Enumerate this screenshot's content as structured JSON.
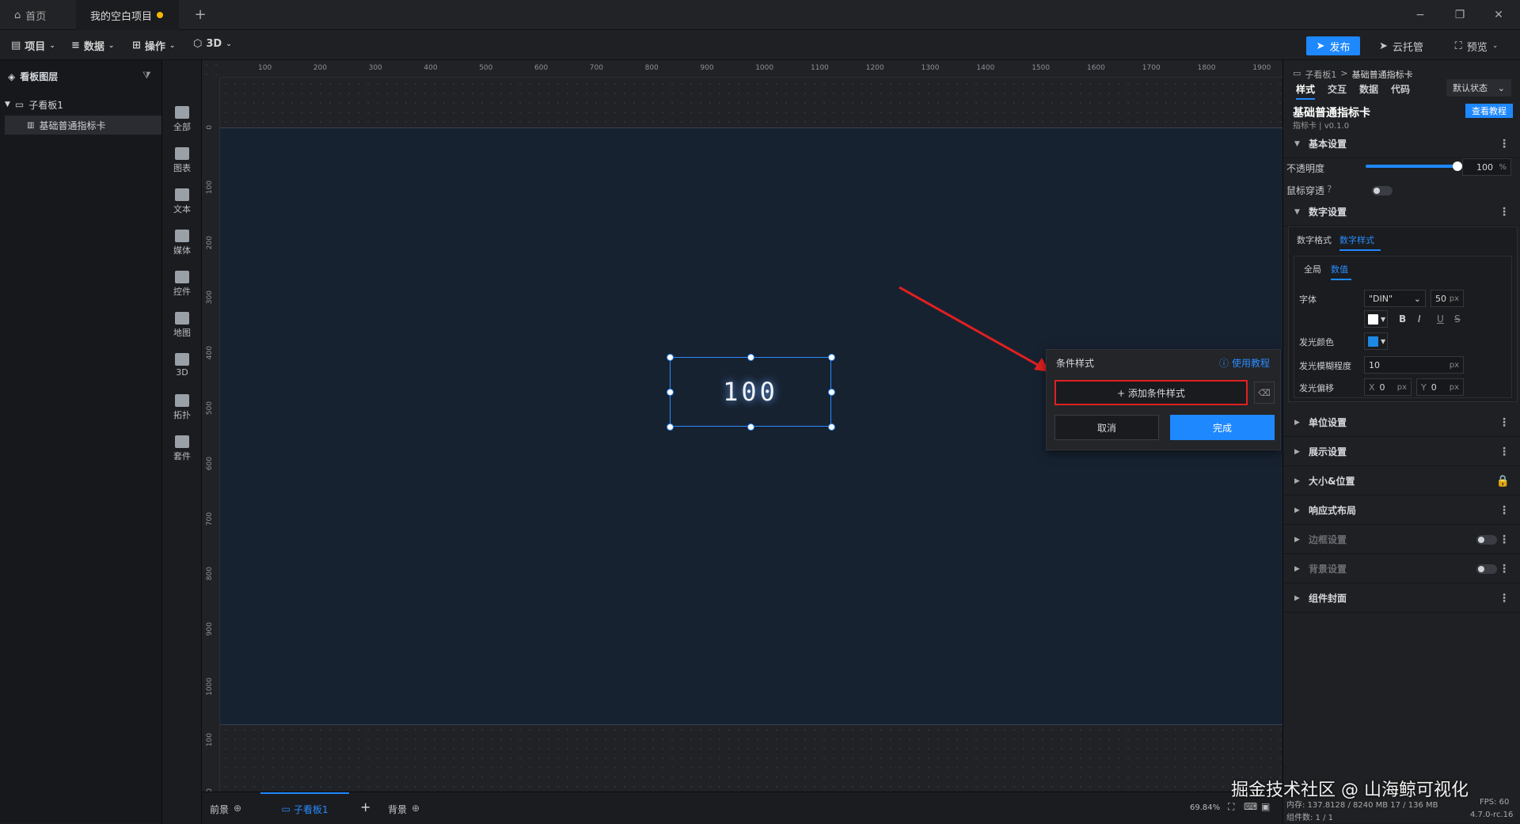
{
  "titlebar": {
    "tabs": [
      {
        "label": "首页"
      },
      {
        "label": "我的空白项目"
      }
    ],
    "add_tab": "+",
    "minimize": "−",
    "restore": "❐",
    "close": "✕"
  },
  "menubar": {
    "items": [
      {
        "label": "项目"
      },
      {
        "label": "数据"
      },
      {
        "label": "操作"
      },
      {
        "label": "3D"
      }
    ],
    "publish": "发布",
    "cloud": "云托管",
    "preview": "预览"
  },
  "layers": {
    "title": "看板图层",
    "board": "子看板1",
    "widget": "基础普通指标卡"
  },
  "components": [
    {
      "label": "全部"
    },
    {
      "label": "图表"
    },
    {
      "label": "文本"
    },
    {
      "label": "媒体"
    },
    {
      "label": "控件"
    },
    {
      "label": "地图"
    },
    {
      "label": "3D"
    },
    {
      "label": "拓扑"
    },
    {
      "label": "套件"
    }
  ],
  "ruler": {
    "top": [
      "100",
      "200",
      "300",
      "400",
      "500",
      "600",
      "700",
      "800",
      "900",
      "1000",
      "1100",
      "1200",
      "1300",
      "1400",
      "1500",
      "1600",
      "1700",
      "1800",
      "1900"
    ],
    "left": [
      "0",
      "100",
      "200",
      "300",
      "400",
      "500",
      "600",
      "700",
      "800",
      "900",
      "1000",
      "100",
      "00"
    ]
  },
  "widget": {
    "value": "100"
  },
  "popup": {
    "title": "条件样式",
    "help": "使用教程",
    "add_button": "+ 添加条件样式",
    "cancel": "取消",
    "done": "完成"
  },
  "bottombar": {
    "front": "前景",
    "board_tab": "子看板1",
    "add": "+",
    "back": "背景",
    "zoom": "69.84%",
    "mem": "内存: 137.8128 / 8240 MB 17 / 136 MB",
    "fps": "FPS: 60",
    "count": "组件数: 1 / 1",
    "version": "4.7.0-rc.16",
    "watermark": "掘金技术社区 @ 山海鲸可视化"
  },
  "rpanel": {
    "breadcrumb_parent": "子看板1",
    "breadcrumb_sep": ">",
    "breadcrumb_current": "基础普通指标卡",
    "tabs": [
      {
        "label": "样式"
      },
      {
        "label": "交互"
      },
      {
        "label": "数据"
      },
      {
        "label": "代码"
      }
    ],
    "state": "默认状态",
    "widget_name": "基础普通指标卡",
    "widget_version": "指标卡 | v0.1.0",
    "tutorial": "查看教程",
    "basic": {
      "title": "基本设置",
      "opacity_label": "不透明度",
      "opacity_value": "100",
      "opacity_unit": "%",
      "opacity_fraction": 1.0,
      "mouse_through": "鼠标穿透"
    },
    "number": {
      "title": "数字设置",
      "subtabs": [
        {
          "label": "数字格式"
        },
        {
          "label": "数字样式"
        }
      ],
      "scope_tabs": [
        {
          "label": "全局"
        },
        {
          "label": "数值"
        }
      ],
      "font_label": "字体",
      "font_value": "\"DIN\"",
      "font_size": "50",
      "unit_px": "px",
      "bold": "B",
      "italic": "I",
      "underline": "U",
      "strike": "S",
      "glow_color_label": "发光颜色",
      "glow_blur_label": "发光模糊程度",
      "glow_blur_value": "10",
      "glow_offset_label": "发光偏移",
      "x_label": "X",
      "x_value": "0",
      "y_label": "Y",
      "y_value": "0",
      "text_color": "#ffffff",
      "glow_color": "#1e88e5"
    },
    "sections": [
      {
        "label": "单位设置"
      },
      {
        "label": "展示设置"
      },
      {
        "label": "大小&位置"
      },
      {
        "label": "响应式布局"
      },
      {
        "label": "边框设置"
      },
      {
        "label": "背景设置"
      },
      {
        "label": "组件封面"
      }
    ]
  },
  "colors": {
    "accent": "#1e88ff",
    "highlight_box": "#e02020",
    "arrow": "#e02020"
  }
}
